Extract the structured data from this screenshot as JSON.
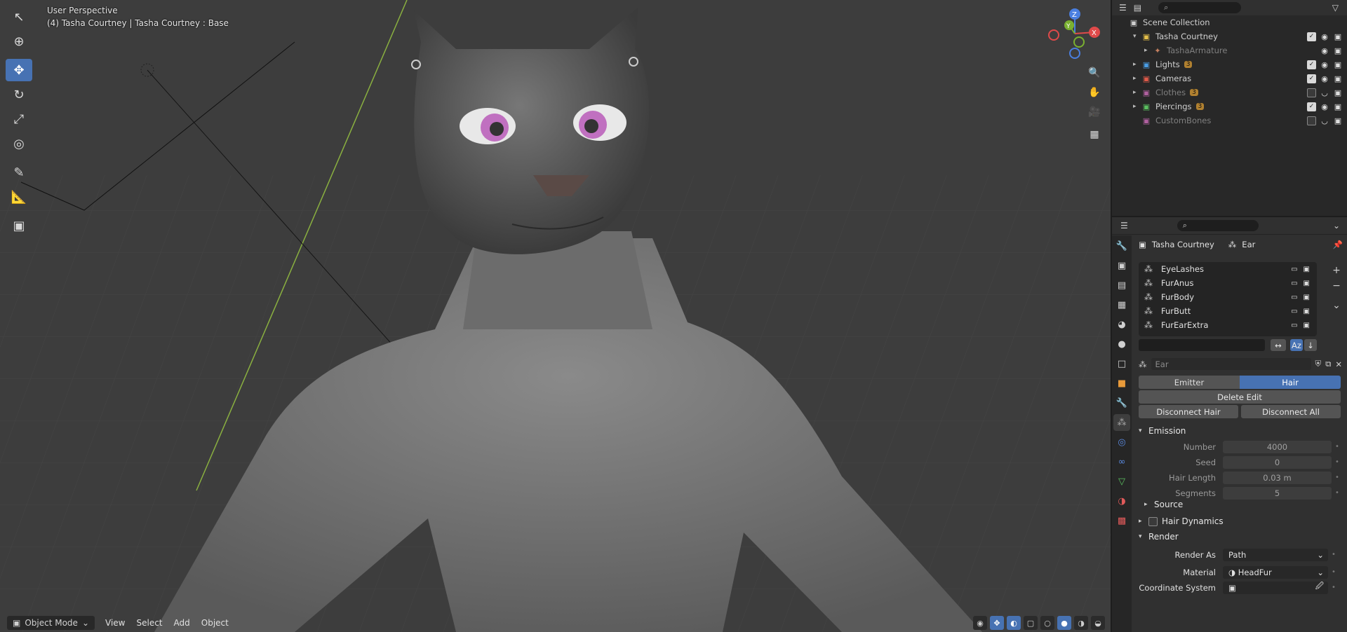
{
  "viewport": {
    "view_name": "User Perspective",
    "object_info": "(4) Tasha Courtney | Tasha Courtney : Base",
    "tools": [
      "select-box-icon",
      "cursor-icon",
      "move-icon",
      "rotate-icon",
      "scale-icon",
      "transform-icon",
      "annotate-icon",
      "measure-icon",
      "add-cube-icon"
    ],
    "gizmo": {
      "z": "Z",
      "y": "Y",
      "x": "X"
    },
    "nav_buttons": [
      "zoom-icon",
      "pan-hand-icon",
      "camera-view-icon",
      "ortho-grid-icon"
    ],
    "header": {
      "mode": "Object Mode",
      "menus": [
        "View",
        "Select",
        "Add",
        "Object"
      ]
    }
  },
  "outliner": {
    "root": "Scene Collection",
    "rows": [
      {
        "name": "Tasha Courtney",
        "level": 1,
        "expanded": true,
        "icon_color": "#e6c04a",
        "checked": true,
        "dim": false
      },
      {
        "name": "TashaArmature",
        "level": 2,
        "expanded": false,
        "icon_color": "#c58060",
        "checked": null,
        "dim": true
      },
      {
        "name": "Lights",
        "level": 1,
        "expanded": false,
        "icon_color": "#4a9ee6",
        "checked": true,
        "dim": false,
        "badge": "3"
      },
      {
        "name": "Cameras",
        "level": 1,
        "expanded": false,
        "icon_color": "#e05a4a",
        "checked": true,
        "dim": false
      },
      {
        "name": "Clothes",
        "level": 1,
        "expanded": false,
        "icon_color": "#b060a0",
        "checked": false,
        "dim": true,
        "badge": "3"
      },
      {
        "name": "Piercings",
        "level": 1,
        "expanded": false,
        "icon_color": "#5ac060",
        "checked": true,
        "dim": false,
        "badge": "3"
      },
      {
        "name": "CustomBones",
        "level": 1,
        "expanded": null,
        "icon_color": "#b060a0",
        "checked": false,
        "dim": true
      }
    ]
  },
  "properties": {
    "breadcrumb": {
      "object": "Tasha Courtney",
      "system": "Ear"
    },
    "particle_systems": [
      "EyeLashes",
      "FurAnus",
      "FurBody",
      "FurButt",
      "FurEarExtra"
    ],
    "settings_name": "Ear",
    "type_toggle": [
      "Emitter",
      "Hair"
    ],
    "active_type": "Hair",
    "delete_edit": "Delete Edit",
    "disconnect_hair": "Disconnect Hair",
    "disconnect_all": "Disconnect All",
    "emission": {
      "title": "Emission",
      "fields": [
        {
          "label": "Number",
          "value": "4000"
        },
        {
          "label": "Seed",
          "value": "0"
        },
        {
          "label": "Hair Length",
          "value": "0.03 m"
        },
        {
          "label": "Segments",
          "value": "5"
        }
      ]
    },
    "source_title": "Source",
    "hair_dynamics_title": "Hair Dynamics",
    "render": {
      "title": "Render",
      "render_as_label": "Render As",
      "render_as_value": "Path",
      "material_label": "Material",
      "material_value": "HeadFur",
      "coord_label": "Coordinate System"
    }
  },
  "colors": {
    "accent": "#4772b3",
    "viewport_bg": "#3d3d3d",
    "panel_bg": "#303030"
  }
}
